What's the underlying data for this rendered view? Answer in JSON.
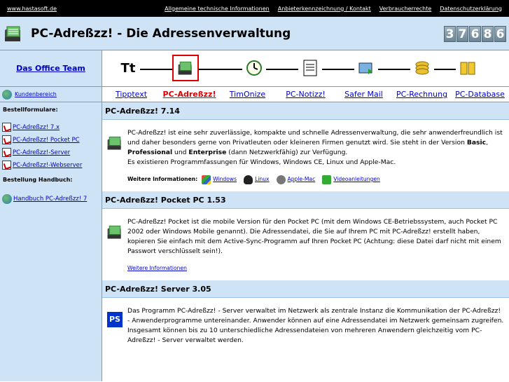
{
  "topbar": {
    "site": "www.hastasoft.de",
    "links": [
      "Allgemeine technische Informationen",
      "Anbieterkennzeichnung / Kontakt",
      "Verbraucherrechte",
      "Datenschutzerklärung"
    ]
  },
  "header": {
    "title_main": "PC-Adreßzz!",
    "title_sep": " - ",
    "title_sub": "Die Adressenverwaltung",
    "counter": [
      "3",
      "7",
      "6",
      "8",
      "6"
    ]
  },
  "nav": {
    "team_link": "Das Office Team",
    "tt_label": "Tt",
    "kundenbereich": "Kundenbereich",
    "tabs": [
      "Tipptext",
      "PC-Adreßzz!",
      "TimOnize",
      "PC-Notizz!",
      "Safer Mail",
      "PC-Rechnung",
      "PC-Database"
    ],
    "active_tab": "PC-Adreßzz!"
  },
  "sidebar": {
    "bestell_title": "Bestellformulare:",
    "bestell_items": [
      "PC-Adreßzz! 7.x",
      "PC-Adreßzz! Pocket PC",
      "PC-Adreßzz!-Server",
      "PC-Adreßzz!-Webserver"
    ],
    "handbuch_title": "Bestellung Handbuch:",
    "handbuch_item": "Handbuch PC-Adreßzz! 7"
  },
  "sections": [
    {
      "title": "PC-Adreßzz! 7.14",
      "text_1": "PC-Adreßzz! ist eine sehr zuverlässige, kompakte und schnelle Adressenverwaltung, die sehr anwenderfreundlich ist und daher besonders gerne von Privatleuten oder kleineren Firmen genutzt wird. Sie steht in der Version ",
      "basic": "Basic",
      "comma": ", ",
      "professional": "Professional",
      "und": " und ",
      "enterprise": "Enterprise",
      "text_2": " (dann Netzwerkfähig) zur Verfügung.",
      "text_3": "Es existieren Programmfassungen für Windows, Windows CE, Linux und Apple-Mac.",
      "more_label": "Weitere Informationen:",
      "more_links": [
        "Windows",
        "Linux",
        "Apple-Mac",
        "Videoanleitungen"
      ]
    },
    {
      "title": "PC-Adreßzz! Pocket PC 1.53",
      "text": "PC-Adreßzz! Pocket ist die mobile Version für den Pocket PC (mit dem Windows CE-Betriebssystem, auch Pocket PC 2002 oder Windows Mobile genannt). Die Adressendatei, die Sie auf Ihrem PC mit PC-Adreßzz! erstellt haben, kopieren Sie einfach mit dem Active-Sync-Programm auf Ihren Pocket PC (Achtung: diese Datei darf nicht mit einem Passwort verschlüsselt sein!).",
      "link": "Weitere Informationen"
    },
    {
      "title": "PC-Adreßzz! Server 3.05",
      "logo_text": "PS",
      "text": "Das Programm PC-Adreßzz! - Server verwaltet im Netzwerk als zentrale Instanz die Kommunikation der PC-Adreßzz! - Anwenderprogramme untereinander. Anwender können auf eine Adressendatei im Netzwerk gemeinsam zugreifen. Insgesamt können bis zu 10 unterschiedliche Adressendateien von mehreren Anwendern gleichzeitig vom PC-Adreßzz! - Server verwaltet werden."
    }
  ]
}
